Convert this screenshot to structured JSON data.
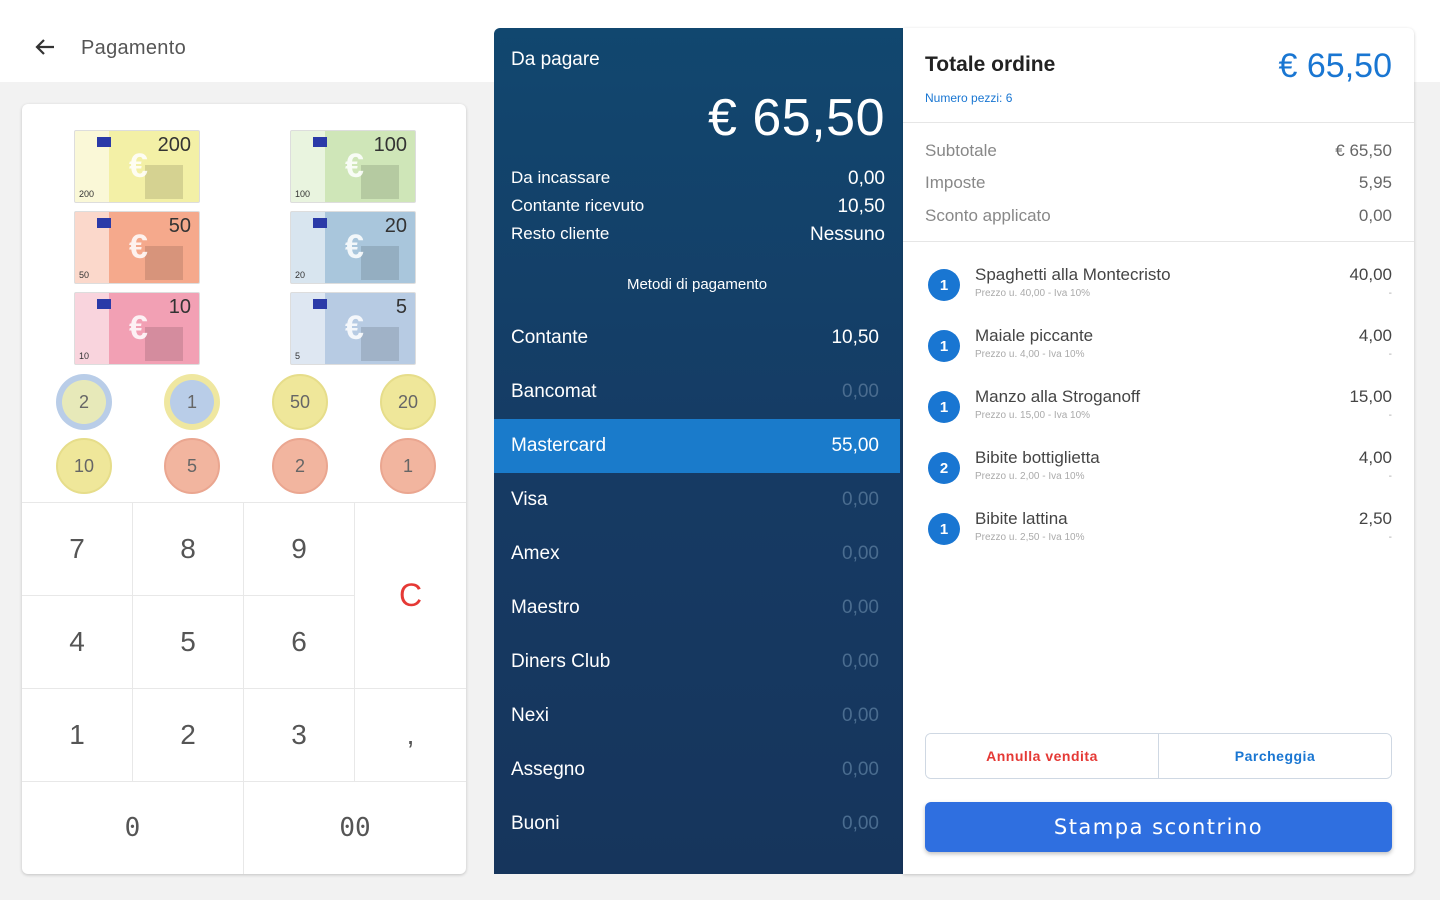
{
  "header": {
    "back_icon": "arrow-left-icon",
    "title": "Pagamento"
  },
  "cash": {
    "bills": [
      {
        "value": "200",
        "small": "200",
        "color": "#f3f0a6"
      },
      {
        "value": "100",
        "small": "100",
        "color": "#cfe6b8"
      },
      {
        "value": "50",
        "small": "50",
        "color": "#f5a98c"
      },
      {
        "value": "20",
        "small": "20",
        "color": "#a9c6dc"
      },
      {
        "value": "10",
        "small": "10",
        "color": "#f2a0b4"
      },
      {
        "value": "5",
        "small": "5",
        "color": "#b7cbe3"
      }
    ],
    "coins": [
      {
        "value": "2",
        "kind": "bi"
      },
      {
        "value": "1",
        "kind": "bi2"
      },
      {
        "value": "50",
        "kind": "gold"
      },
      {
        "value": "20",
        "kind": "gold"
      },
      {
        "value": "10",
        "kind": "gold"
      },
      {
        "value": "5",
        "kind": "copper"
      },
      {
        "value": "2",
        "kind": "copper"
      },
      {
        "value": "1",
        "kind": "copper"
      }
    ]
  },
  "keypad": {
    "k7": "7",
    "k8": "8",
    "k9": "9",
    "clear": "C",
    "k4": "4",
    "k5": "5",
    "k6": "6",
    "k1": "1",
    "k2": "2",
    "k3": "3",
    "comma": ",",
    "k0": "0",
    "k00": "00"
  },
  "payment": {
    "due_label": "Da pagare",
    "due_amount": "€ 65,50",
    "to_collect_label": "Da incassare",
    "to_collect_value": "0,00",
    "cash_received_label": "Contante ricevuto",
    "cash_received_value": "10,50",
    "change_label": "Resto cliente",
    "change_value": "Nessuno",
    "methods_title": "Metodi di pagamento",
    "methods": [
      {
        "name": "Contante",
        "amount": "10,50",
        "state": "filled"
      },
      {
        "name": "Bancomat",
        "amount": "0,00",
        "state": "zero"
      },
      {
        "name": "Mastercard",
        "amount": "55,00",
        "state": "selected"
      },
      {
        "name": "Visa",
        "amount": "0,00",
        "state": "zero"
      },
      {
        "name": "Amex",
        "amount": "0,00",
        "state": "zero"
      },
      {
        "name": "Maestro",
        "amount": "0,00",
        "state": "zero"
      },
      {
        "name": "Diners Club",
        "amount": "0,00",
        "state": "zero"
      },
      {
        "name": "Nexi",
        "amount": "0,00",
        "state": "zero"
      },
      {
        "name": "Assegno",
        "amount": "0,00",
        "state": "zero"
      },
      {
        "name": "Buoni",
        "amount": "0,00",
        "state": "zero"
      }
    ]
  },
  "order": {
    "title": "Totale ordine",
    "total": "€ 65,50",
    "pieces": "Numero pezzi: 6",
    "subtotal_label": "Subtotale",
    "subtotal_value": "€ 65,50",
    "taxes_label": "Imposte",
    "taxes_value": "5,95",
    "discount_label": "Sconto applicato",
    "discount_value": "0,00",
    "items": [
      {
        "qty": "1",
        "name": "Spaghetti alla Montecristo",
        "detail": "Prezzo u. 40,00 - Iva 10%",
        "price": "40,00",
        "dash": "-"
      },
      {
        "qty": "1",
        "name": "Maiale piccante",
        "detail": "Prezzo u. 4,00 - Iva 10%",
        "price": "4,00",
        "dash": "-"
      },
      {
        "qty": "1",
        "name": "Manzo alla Stroganoff",
        "detail": "Prezzo u. 15,00 - Iva 10%",
        "price": "15,00",
        "dash": "-"
      },
      {
        "qty": "2",
        "name": "Bibite bottiglietta",
        "detail": "Prezzo u. 2,00 - Iva 10%",
        "price": "4,00",
        "dash": "-"
      },
      {
        "qty": "1",
        "name": "Bibite lattina",
        "detail": "Prezzo u. 2,50 - Iva 10%",
        "price": "2,50",
        "dash": "-"
      }
    ],
    "cancel_label": "Annulla vendita",
    "park_label": "Parcheggia",
    "print_label": "Stampa scontrino"
  },
  "colors": {
    "accent": "#1976d2",
    "panel": "#163a63",
    "selected": "#1a7bcb",
    "danger": "#e53935",
    "primary_button": "#2f6fe0"
  }
}
